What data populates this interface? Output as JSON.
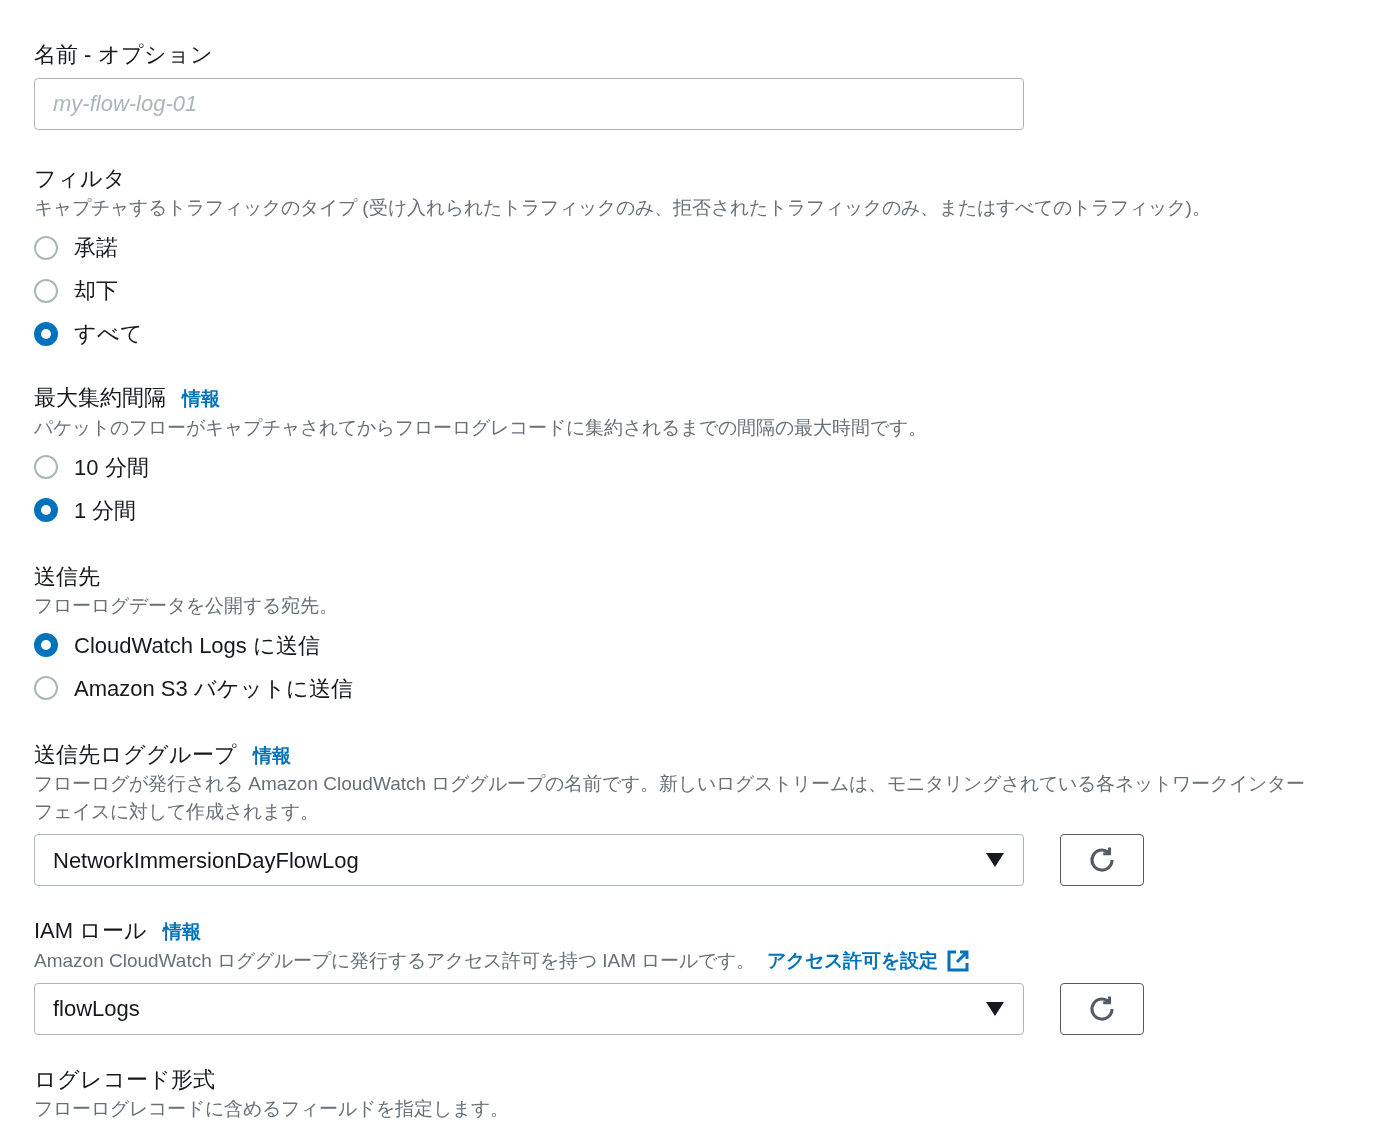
{
  "sections": [
    {
      "kind": "text",
      "label": "名前 - オプション",
      "placeholder": "my-flow-log-01"
    },
    {
      "kind": "radio",
      "label": "フィルタ",
      "description": "キャプチャするトラフィックのタイプ (受け入れられたトラフィックのみ、拒否されたトラフィックのみ、またはすべてのトラフィック)。",
      "options": [
        {
          "label": "承諾",
          "selected": false
        },
        {
          "label": "却下",
          "selected": false
        },
        {
          "label": "すべて",
          "selected": true
        }
      ]
    },
    {
      "kind": "radio",
      "label": "最大集約間隔",
      "info": "情報",
      "description": "パケットのフローがキャプチャされてからフローログレコードに集約されるまでの間隔の最大時間です。",
      "options": [
        {
          "label": "10 分間",
          "selected": false
        },
        {
          "label": "1 分間",
          "selected": true
        }
      ]
    },
    {
      "kind": "radio",
      "label": "送信先",
      "description": "フローログデータを公開する宛先。",
      "options": [
        {
          "label": "CloudWatch Logs に送信",
          "selected": true
        },
        {
          "label": "Amazon S3 バケットに送信",
          "selected": false
        }
      ]
    },
    {
      "kind": "select",
      "label": "送信先ロググループ",
      "info": "情報",
      "description": "フローログが発行される Amazon CloudWatch ロググループの名前です。新しいログストリームは、モニタリングされている各ネットワークインターフェイスに対して作成されます。",
      "value": "NetworkImmersionDayFlowLog"
    },
    {
      "kind": "select",
      "label": "IAM ロール",
      "info": "情報",
      "description": "Amazon CloudWatch ロググループに発行するアクセス許可を持つ IAM ロールです。",
      "link": "アクセス許可を設定",
      "value": "flowLogs"
    },
    {
      "kind": "heading",
      "label": "ログレコード形式",
      "description": "フローログレコードに含めるフィールドを指定します。"
    }
  ]
}
